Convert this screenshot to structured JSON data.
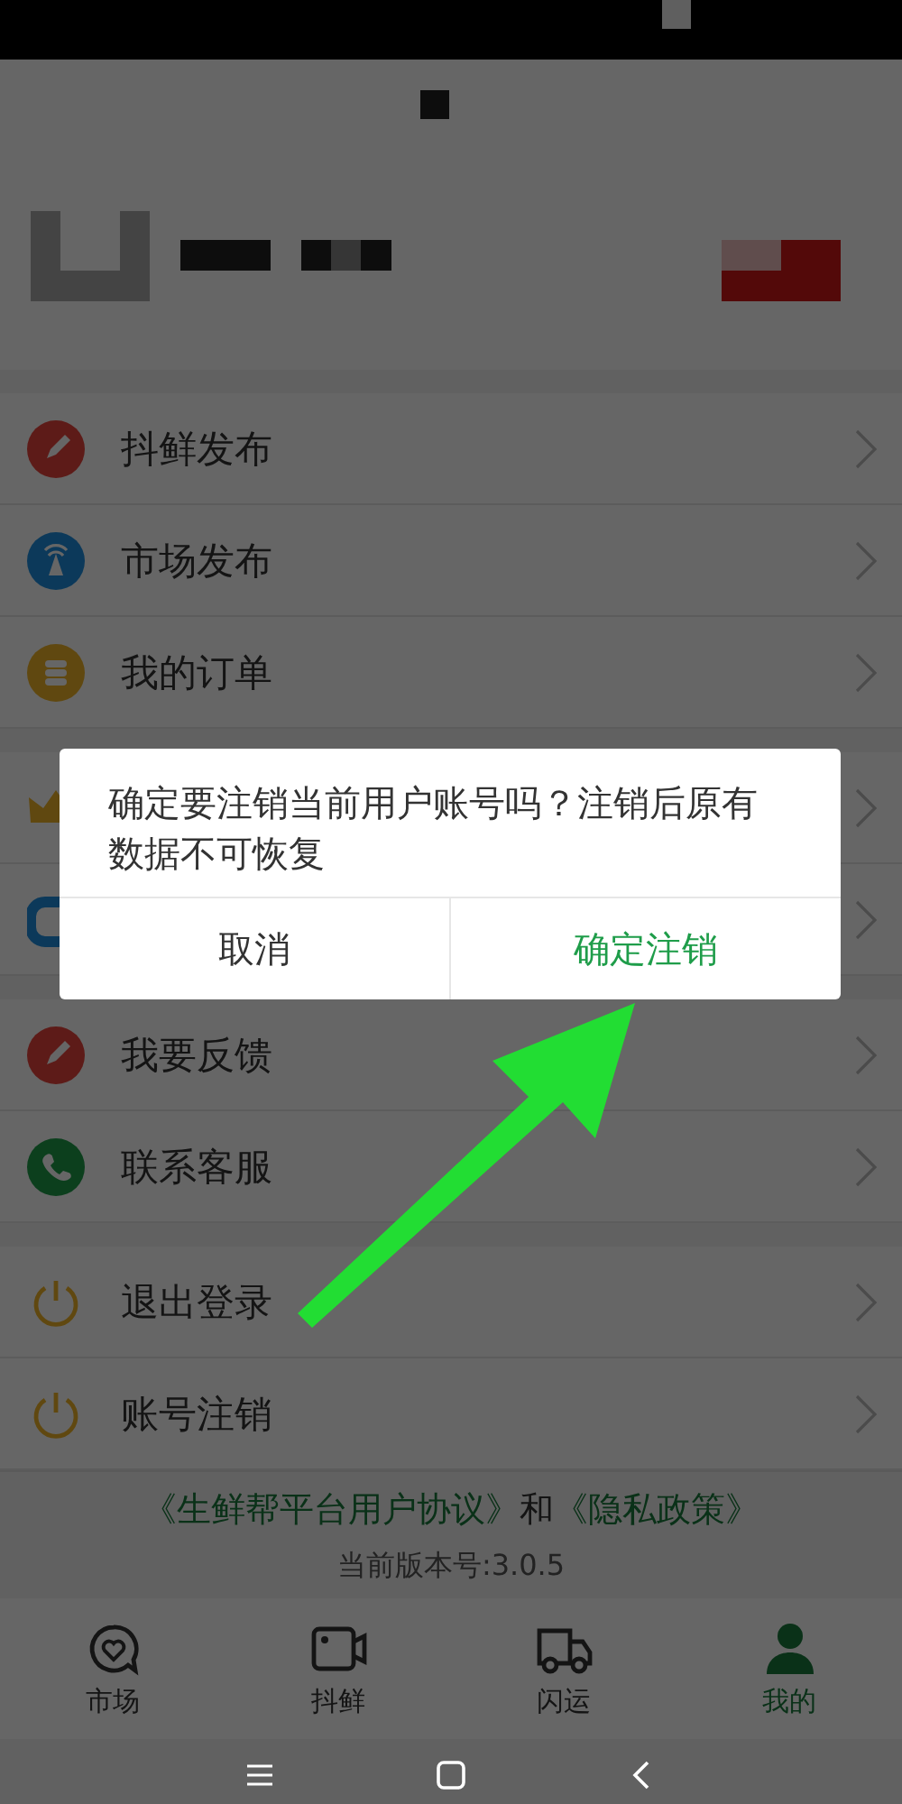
{
  "menu_groups": [
    [
      {
        "kind": "item",
        "label": "抖鲜发布"
      },
      {
        "kind": "item",
        "label": "市场发布"
      },
      {
        "kind": "item",
        "label": "我的订单"
      }
    ],
    [
      {
        "kind": "covered"
      },
      {
        "kind": "covered"
      }
    ],
    [
      {
        "kind": "item",
        "label": "我要反馈"
      },
      {
        "kind": "item",
        "label": "联系客服"
      }
    ],
    [
      {
        "kind": "item",
        "label": "退出登录"
      },
      {
        "kind": "item",
        "label": "账号注销"
      }
    ]
  ],
  "footer": {
    "agreement_link": "《生鲜帮平台用户协议》",
    "conjunction": "和",
    "privacy_link": "《隐私政策》",
    "version": "当前版本号:3.0.5"
  },
  "tabs": [
    {
      "label": "市场",
      "selected": false
    },
    {
      "label": "抖鲜",
      "selected": false
    },
    {
      "label": "闪运",
      "selected": false
    },
    {
      "label": "我的",
      "selected": true
    }
  ],
  "dialog": {
    "message": "确定要注销当前用户账号吗？注销后原有数据不可恢复",
    "buttons": [
      {
        "label": "取消",
        "kind": "cancel"
      },
      {
        "label": "确定注销",
        "kind": "confirm"
      }
    ]
  }
}
